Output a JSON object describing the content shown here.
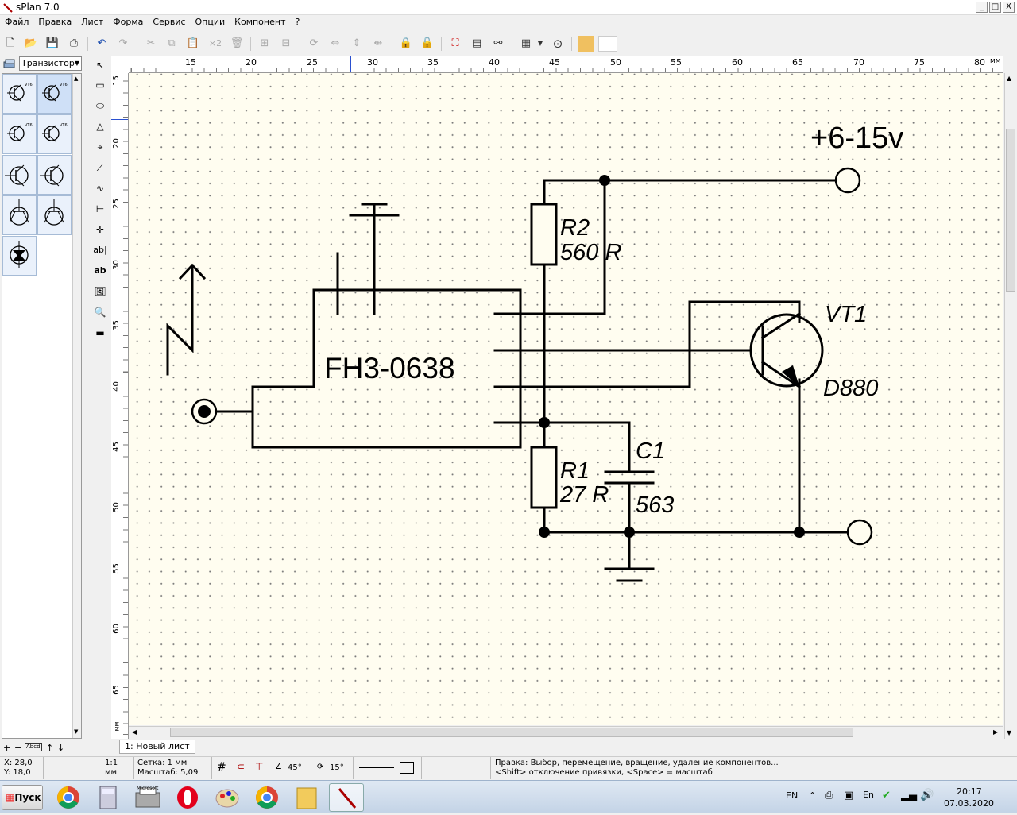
{
  "window": {
    "title": "sPlan 7.0",
    "min_label": "_",
    "max_label": "□",
    "close_label": "X"
  },
  "menu": [
    "Файл",
    "Правка",
    "Лист",
    "Форма",
    "Сервис",
    "Опции",
    "Компонент",
    "?"
  ],
  "library": {
    "selected_group": "Транзистор",
    "bottom_controls": [
      "+",
      "−",
      "Abcd",
      "↑",
      "↓"
    ]
  },
  "ruler": {
    "unit": "мм",
    "h_ticks": [
      "15",
      "20",
      "25",
      "30",
      "35",
      "40",
      "45",
      "50",
      "55",
      "60",
      "65",
      "70",
      "75",
      "80"
    ],
    "v_ticks": [
      "15",
      "20",
      "25",
      "30",
      "35",
      "40",
      "45",
      "50",
      "55",
      "60",
      "65"
    ]
  },
  "schematic": {
    "labels": {
      "power": "+6-15v",
      "r2_name": "R2",
      "r2_value": "560 R",
      "r1_name": "R1",
      "r1_value": "27 R",
      "c1_name": "C1",
      "c1_value": "563",
      "vt1_name": "VT1",
      "vt1_value": "D880",
      "chip": "FH3-0638"
    },
    "symbol_labels": {
      "vt": "VT6",
      "vt_alt": "VT1"
    }
  },
  "sheet_tab": "1: Новый лист",
  "status": {
    "x": "X: 28,0",
    "y": "Y: 18,0",
    "scale_ratio": "1:1",
    "scale_unit": "мм",
    "grid": "Сетка: 1 мм",
    "zoom": "Масштаб:  5,09",
    "angle1": "45°",
    "angle2": "15°",
    "hint1": "Правка: Выбор, перемещение, вращение, удаление компонентов...",
    "hint2": "<Shift> отключение привязки, <Space> = масштаб"
  },
  "taskbar": {
    "start": "Пуск",
    "lang": "EN",
    "time": "20:17",
    "date": "07.03.2020",
    "calc_label": "Microsoft"
  },
  "colors": {
    "canvas_bg": "#fffdf0",
    "grid_dot": "#7a7a7a",
    "wire": "#000000"
  }
}
